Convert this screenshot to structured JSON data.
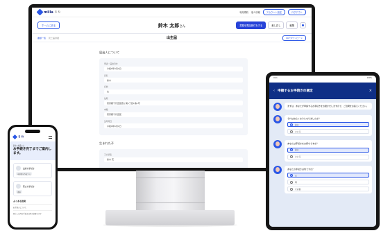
{
  "monitor": {
    "logo": "milla",
    "logo_sub": "る ね",
    "top_links": [
      "利用規約",
      "個人情報"
    ],
    "top_pills": [
      "アカウント設定",
      "ログアウト"
    ],
    "back_button": "ホームに戻る",
    "user_name": "鈴木 太郎",
    "user_suffix": "さん",
    "primary_button": "書類を電話受付をする",
    "secondary_button": "差し戻し",
    "edit_button": "編集",
    "breadcrumb": "書類一覧",
    "breadcrumb_current": "死亡届詳細",
    "doc_title": "出生届",
    "side_button": "PDFダウンロード",
    "section1_title": "届出人について",
    "fields": [
      {
        "label": "申請・届出日付",
        "value": "令和6年9月1日"
      },
      {
        "label": "氏名",
        "value": "鈴木"
      },
      {
        "label": "名前",
        "value": "太"
      },
      {
        "label": "住所",
        "value": "東京都千代田区霞ヶ関1丁目1番1号"
      },
      {
        "label": "本籍",
        "value": "東京都千代田区"
      },
      {
        "label": "生年月日",
        "value": "令和6年6月1日"
      }
    ],
    "section2_title": "生まれた子",
    "section2_fields": [
      {
        "label": "子の氏名",
        "value": "鈴木 花"
      }
    ]
  },
  "phone": {
    "logo": "る ね",
    "greeting_small": "鈴木 太郎さん",
    "headline": "お手続き完了までご案内します。",
    "card_items": [
      {
        "label": "出産の手続き",
        "chip": "申請書を作成する"
      },
      {
        "label": "死亡の手続き",
        "chip": "書類"
      }
    ],
    "faq_title": "よくある質問",
    "faq_items": [
      "お手続きについて",
      "死亡した時の手続きは何が必要ですか"
    ]
  },
  "tablet": {
    "status_time": "9:41",
    "status_right": "100%",
    "title": "申請するお手続きの選定",
    "questions": [
      {
        "text": "まずは、あなたが申請するお手続きをお聞かせしますので、ご質問をお答えください。",
        "options": []
      },
      {
        "text": "それはお亡くなりになりましたか？",
        "options": [
          {
            "label": "はい",
            "selected": true
          },
          {
            "label": "いいえ",
            "selected": false
          }
        ]
      },
      {
        "text": "あなたは手続きをお持ちですか？",
        "options": [
          {
            "label": "はい",
            "selected": true
          },
          {
            "label": "いいえ",
            "selected": false
          }
        ]
      },
      {
        "text": "あなたの手続きは何ですか？",
        "options": [
          {
            "label": "父",
            "selected": true
          },
          {
            "label": "母",
            "selected": false
          },
          {
            "label": "その他",
            "selected": false
          }
        ]
      }
    ]
  }
}
